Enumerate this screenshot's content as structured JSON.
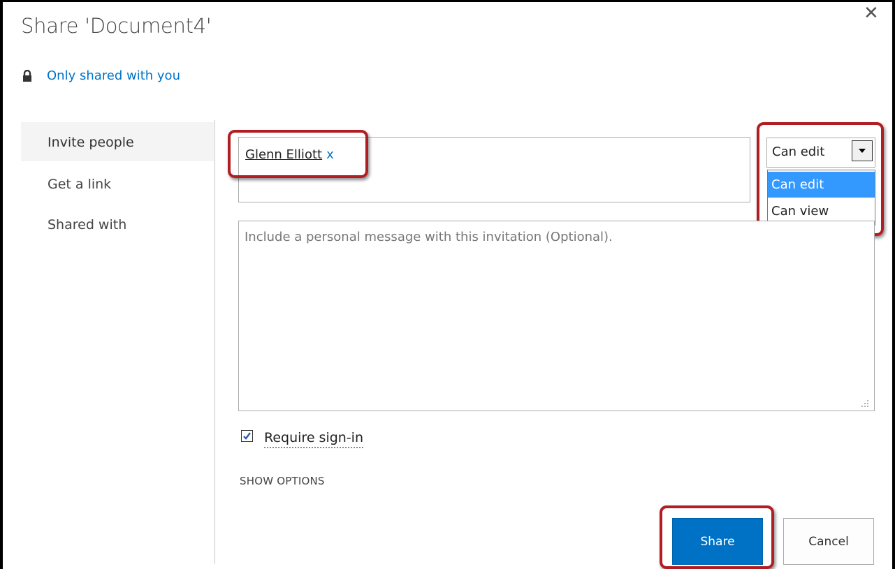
{
  "dialog": {
    "title": "Share 'Document4'",
    "close_label": "✕",
    "sharing_status": "Only shared with you"
  },
  "nav": {
    "items": [
      {
        "label": "Invite people",
        "active": true
      },
      {
        "label": "Get a link",
        "active": false
      },
      {
        "label": "Shared with",
        "active": false
      }
    ]
  },
  "invite": {
    "person_name": "Glenn Elliott",
    "remove_label": "x",
    "permission": {
      "selected": "Can edit",
      "options": [
        "Can edit",
        "Can view"
      ]
    },
    "message_placeholder": "Include a personal message with this invitation (Optional).",
    "require_signin_label": "Require sign-in",
    "require_signin_checked": true,
    "show_options_label": "SHOW OPTIONS"
  },
  "buttons": {
    "share_label": "Share",
    "cancel_label": "Cancel"
  },
  "colors": {
    "accent": "#0072c6",
    "highlight": "#b01e23",
    "dropdown_selected": "#3399ff"
  }
}
